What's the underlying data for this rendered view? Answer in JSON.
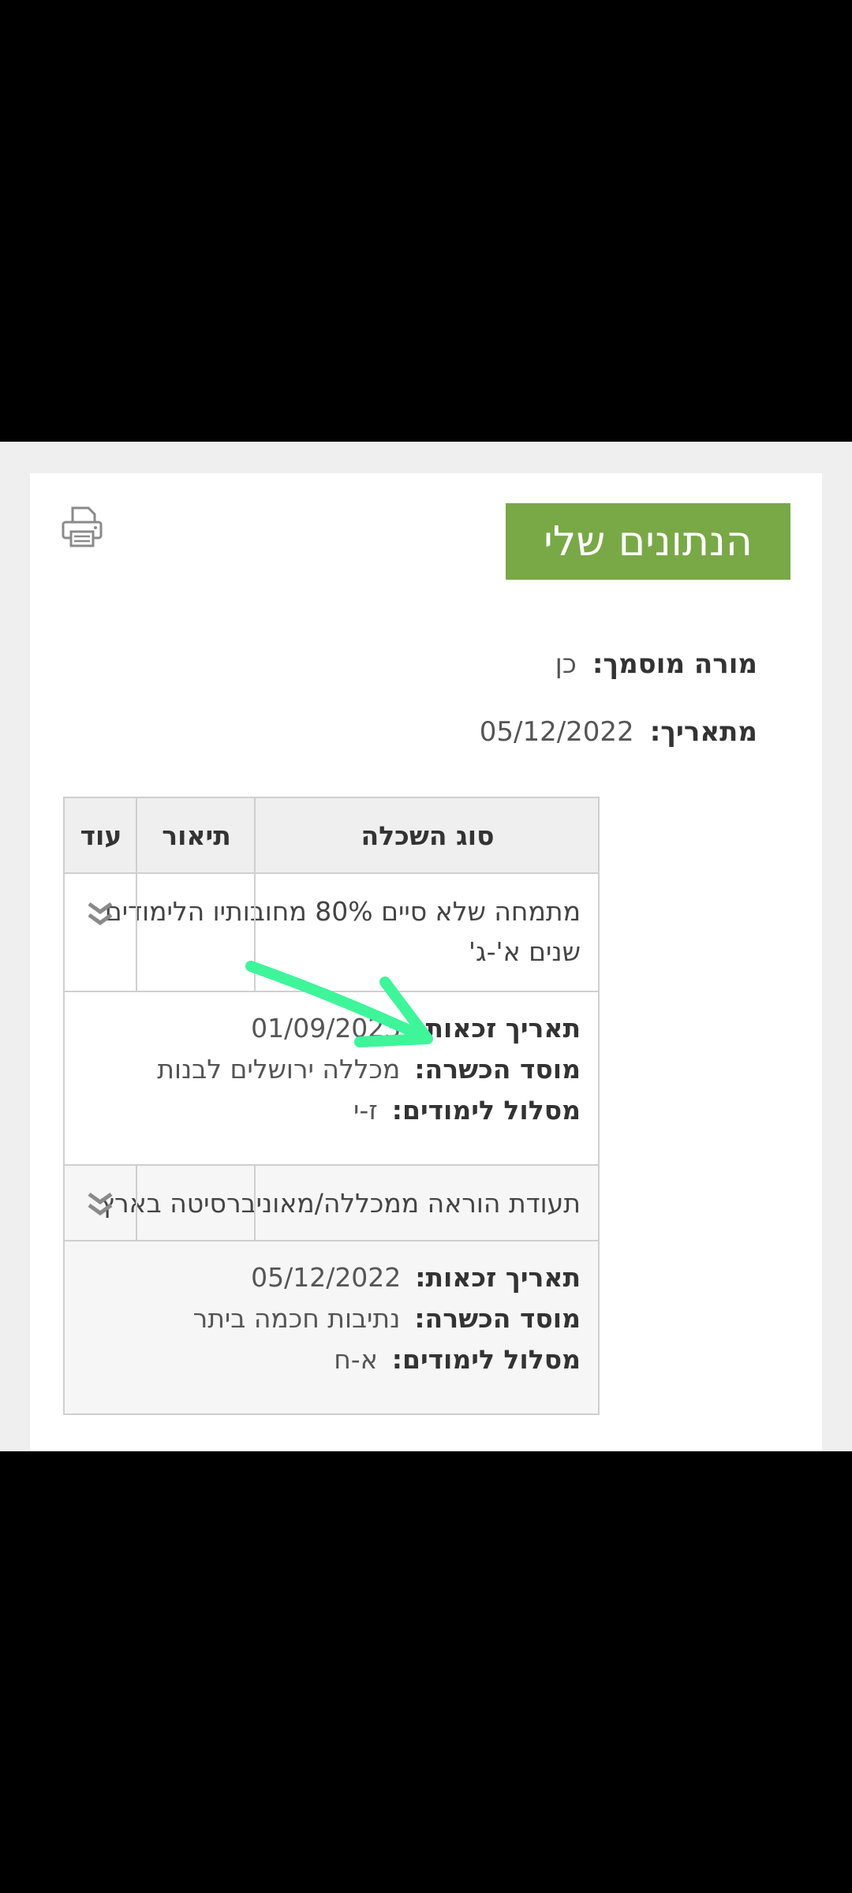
{
  "header": {
    "title": "הנתונים שלי",
    "print_icon": "printer-icon"
  },
  "info": {
    "certified_label": "מורה מוסמך:",
    "certified_value": "כן",
    "date_label": "מתאריך:",
    "date_value": "05/12/2022"
  },
  "table": {
    "headers": {
      "type": "סוג השכלה",
      "description": "תיאור",
      "more": "עוד"
    },
    "rows": [
      {
        "type_line1": "מתמחה שלא סיים 80% מחובותיו הלימודים",
        "type_line2": "שנים א'-ג'",
        "description": "",
        "more_icon": "double-chevron-down-icon",
        "details": {
          "eligibility_label": "תאריך זכאות:",
          "eligibility_value": "01/09/2023",
          "institution_label": "מוסד הכשרה:",
          "institution_value": "מכללה ירושלים לבנות",
          "track_label": "מסלול לימודים:",
          "track_value": "ז-י"
        }
      },
      {
        "type_line1": "תעודת הוראה ממכללה/מאוניברסיטה בארץ",
        "description": "",
        "more_icon": "double-chevron-down-icon",
        "details": {
          "eligibility_label": "תאריך זכאות:",
          "eligibility_value": "05/12/2022",
          "institution_label": "מוסד הכשרה:",
          "institution_value": "נתיבות חכמה ביתר",
          "track_label": "מסלול לימודים:",
          "track_value": "א-ח"
        }
      }
    ]
  },
  "colors": {
    "title_bg": "#79a847",
    "annotation_arrow": "#3ef59a"
  }
}
